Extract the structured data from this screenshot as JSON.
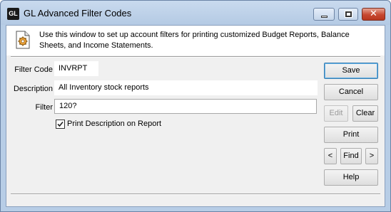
{
  "window": {
    "icon_text": "GL",
    "title": "GL Advanced Filter Codes"
  },
  "info": {
    "icon": "document-gear-icon",
    "text": "Use this window to set up account filters for printing customized Budget Reports, Balance Sheets, and Income Statements."
  },
  "form": {
    "filter_code_label": "Filter Code",
    "filter_code_value": "INVRPT",
    "description_label": "Description",
    "description_value": "All Inventory stock reports",
    "filter_label": "Filter",
    "filter_value": "120?",
    "print_desc_label": "Print Description on Report",
    "print_desc_checked": true
  },
  "buttons": {
    "save": "Save",
    "cancel": "Cancel",
    "edit": "Edit",
    "clear": "Clear",
    "print": "Print",
    "prev": "<",
    "find": "Find",
    "next": ">",
    "help": "Help"
  },
  "colors": {
    "title_bar": "#b7cde6",
    "close_button": "#c6472f",
    "default_button_border": "#3c7fb1"
  }
}
